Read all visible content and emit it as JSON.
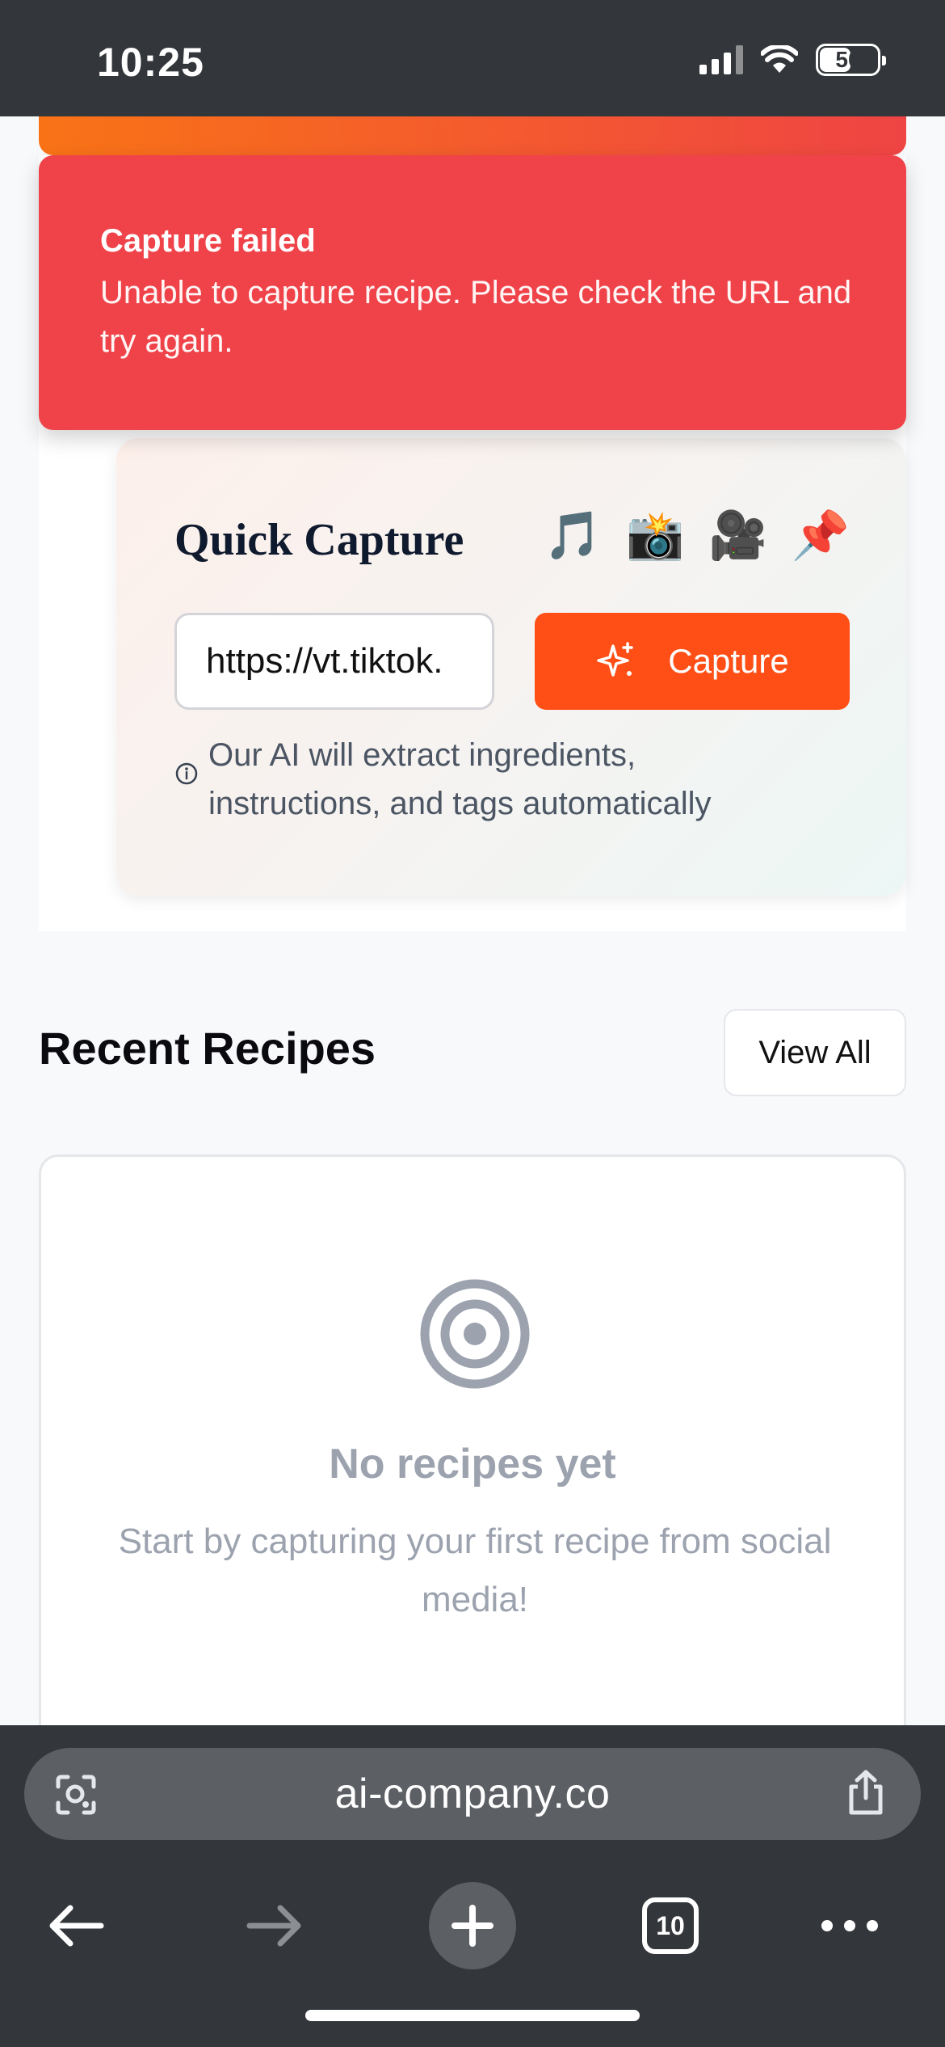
{
  "status_bar": {
    "time": "10:25",
    "battery": "50"
  },
  "toast": {
    "title": "Capture failed",
    "message": "Unable to capture recipe. Please check the URL and try again."
  },
  "quick_capture": {
    "title": "Quick Capture",
    "emojis": [
      "🎵",
      "📸",
      "🎥",
      "📌"
    ],
    "url_value": "https://vt.tiktok.",
    "capture_label": "Capture",
    "hint": "Our AI will extract ingredients, instructions, and tags automatically"
  },
  "recent": {
    "heading": "Recent Recipes",
    "view_all_label": "View All",
    "empty_title": "No recipes yet",
    "empty_desc": "Start by capturing your first recipe from social media!"
  },
  "browser": {
    "url": "ai-company.co",
    "tab_count": "10"
  },
  "colors": {
    "accent": "#ff4f17",
    "toast_bg": "#ef4349",
    "chrome_bg": "#33363a"
  }
}
